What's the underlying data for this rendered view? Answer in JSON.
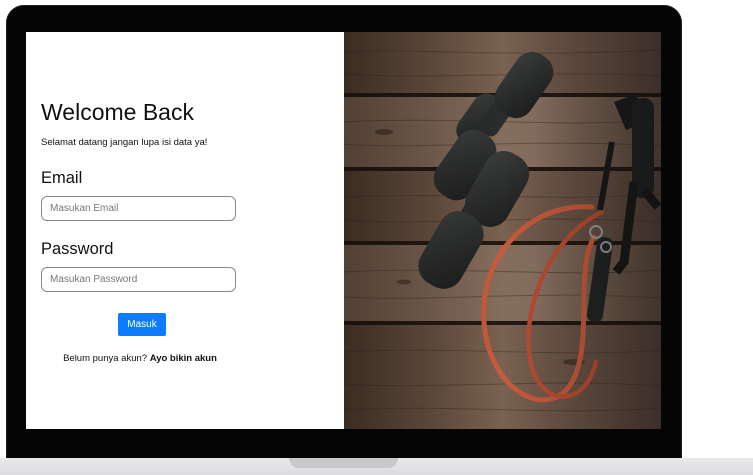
{
  "login": {
    "title": "Welcome Back",
    "subtitle": "Selamat datang jangan lupa isi data ya!",
    "email_label": "Email",
    "email_placeholder": "Masukan Email",
    "email_value": "",
    "password_label": "Password",
    "password_placeholder": "Masukan Password",
    "password_value": "",
    "submit_label": "Masuk",
    "signup_prompt": "Belum punya akun?",
    "signup_link": "Ayo bikin akun"
  },
  "colors": {
    "accent": "#0d7dff",
    "bezel": "#050505",
    "wood": "#6b5543",
    "dumbbell": "#2b2d2c",
    "band": "#c75a3c"
  },
  "illustration": {
    "subject": "dumbbells-and-resistance-band-on-wood"
  }
}
